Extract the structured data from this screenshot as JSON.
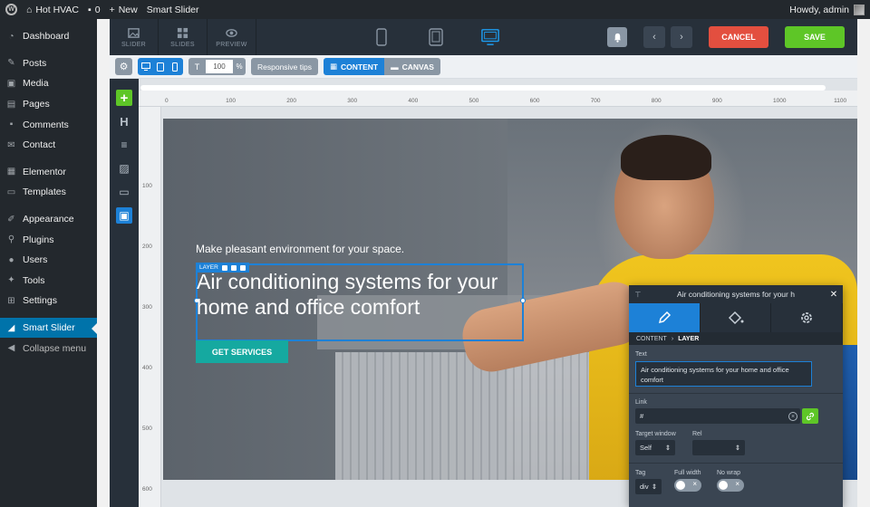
{
  "adminbar": {
    "site_name": "Hot HVAC",
    "comments_count": "0",
    "new_label": "New",
    "page_label": "Smart Slider",
    "greeting": "Howdy, admin"
  },
  "sidebar": {
    "items": [
      {
        "label": "Dashboard",
        "icon": "dashboard-icon"
      },
      {
        "label": "Posts",
        "icon": "pin-icon"
      },
      {
        "label": "Media",
        "icon": "media-icon"
      },
      {
        "label": "Pages",
        "icon": "pages-icon"
      },
      {
        "label": "Comments",
        "icon": "comment-icon"
      },
      {
        "label": "Contact",
        "icon": "mail-icon"
      },
      {
        "label": "Elementor",
        "icon": "elementor-icon"
      },
      {
        "label": "Templates",
        "icon": "folder-icon"
      },
      {
        "label": "Appearance",
        "icon": "brush-icon"
      },
      {
        "label": "Plugins",
        "icon": "plugin-icon"
      },
      {
        "label": "Users",
        "icon": "user-icon"
      },
      {
        "label": "Tools",
        "icon": "wrench-icon"
      },
      {
        "label": "Settings",
        "icon": "settings-icon"
      },
      {
        "label": "Smart Slider",
        "icon": "slider-icon"
      },
      {
        "label": "Collapse menu",
        "icon": "collapse-icon"
      }
    ]
  },
  "toolbar": {
    "slider_label": "SLIDER",
    "slides_label": "SLIDES",
    "preview_label": "PREVIEW",
    "cancel_label": "CANCEL",
    "save_label": "SAVE"
  },
  "subtoolbar": {
    "zoom_value": "100",
    "zoom_unit": "%",
    "responsive_tips": "Responsive tips",
    "content_label": "CONTENT",
    "canvas_label": "CANVAS"
  },
  "ruler": {
    "h_ticks": [
      "0",
      "100",
      "200",
      "300",
      "400",
      "500",
      "600",
      "700",
      "800",
      "900",
      "1000",
      "1100"
    ],
    "v_ticks": [
      "100",
      "200",
      "300",
      "400",
      "500",
      "600"
    ]
  },
  "slide": {
    "subtitle": "Make pleasant environment for your space.",
    "layer_tag": "LAYER",
    "heading": "Air conditioning systems for your home and office comfort",
    "button": "GET SERVICES"
  },
  "panel": {
    "title": "Air conditioning systems for your h",
    "crumb_1": "CONTENT",
    "crumb_2": "LAYER",
    "text_label": "Text",
    "text_value": "Air conditioning systems for your home and office comfort",
    "link_label": "Link",
    "link_value": "#",
    "target_label": "Target window",
    "target_value": "Self",
    "rel_label": "Rel",
    "rel_value": "",
    "tag_label": "Tag",
    "tag_value": "div",
    "fullwidth_label": "Full width",
    "nowrap_label": "No wrap"
  },
  "colors": {
    "wp_dark": "#23282d",
    "wp_blue": "#0073aa",
    "ss_dark": "#27303a",
    "ss_blue": "#1d81d7",
    "cancel_red": "#e34f3f",
    "save_green": "#5ec627",
    "cta_teal": "#15a9a0"
  }
}
